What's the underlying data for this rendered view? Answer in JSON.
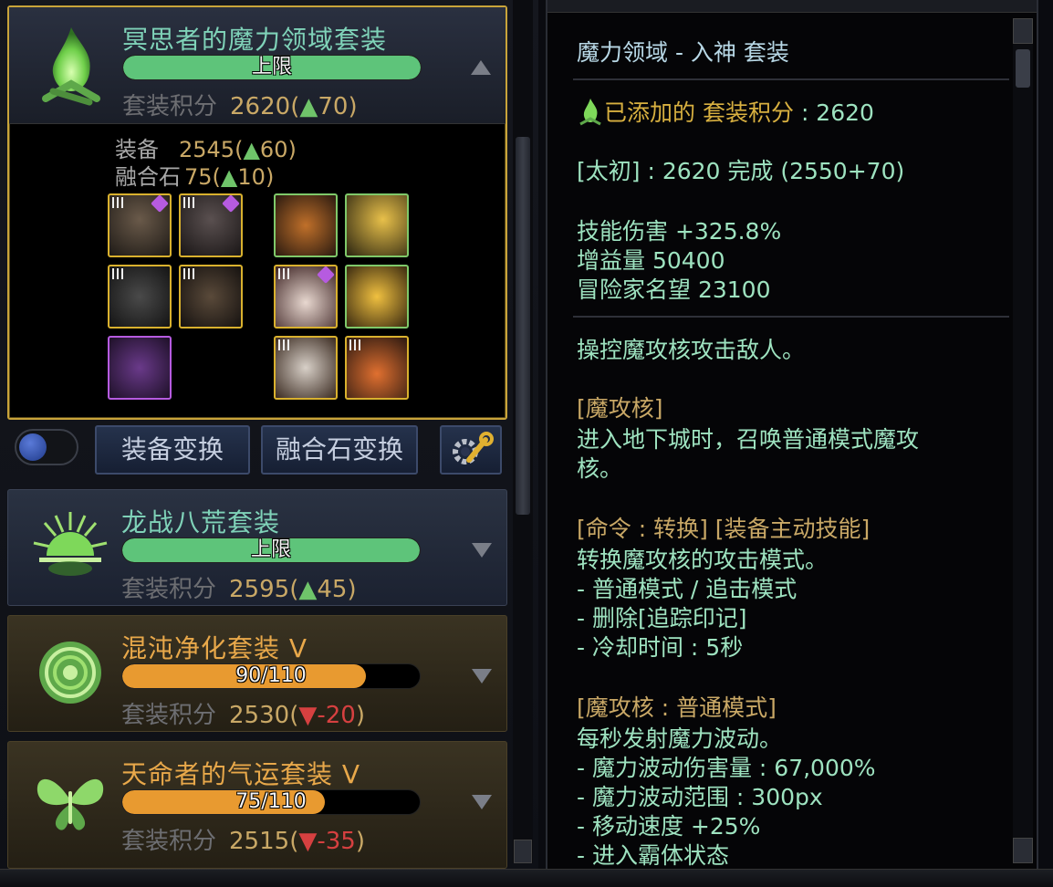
{
  "sets": [
    {
      "name": "冥思者的魔力领域套装",
      "bar_text": "上限",
      "bar_fill": 1.0,
      "score_label": "套装积分",
      "score": "2620",
      "delta_arrow": "▲",
      "delta": "70",
      "delta_dir": "up",
      "equip_label": "装备",
      "equip_value": "2545",
      "equip_delta": "60",
      "stone_label": "融合石",
      "stone_value": "75",
      "stone_delta": "10"
    },
    {
      "name": "龙战八荒套装",
      "bar_text": "上限",
      "bar_fill": 1.0,
      "score_label": "套装积分",
      "score": "2595",
      "delta_arrow": "▲",
      "delta": "45",
      "delta_dir": "up"
    },
    {
      "name": "混沌净化套装 V",
      "bar_text": "90/110",
      "bar_fill": 0.818,
      "score_label": "套装积分",
      "score": "2530",
      "delta_arrow": "▼",
      "delta": "-20",
      "delta_dir": "down"
    },
    {
      "name": "天命者的气运套装 V",
      "bar_text": "75/110",
      "bar_fill": 0.682,
      "score_label": "套装积分",
      "score": "2515",
      "delta_arrow": "▼",
      "delta": "-35",
      "delta_dir": "down"
    }
  ],
  "buttons": {
    "equip_switch": "装备变换",
    "stone_switch": "融合石变换"
  },
  "colors": {
    "frame_gold": "#c9a43a",
    "bar_green": "#5ec47a",
    "bar_orange": "#e89a30",
    "text_green": "#9ee3c0",
    "text_orange": "#c9a866"
  },
  "detail": {
    "title": "魔力领域 - 入神 套装",
    "added_prefix": "已添加的",
    "added_label": "套装积分",
    "added_value": ": 2620",
    "taichu": "[太初] : 2620 完成 (2550+70)",
    "stat1": "技能伤害 +325.8%",
    "stat2": "增益量 50400",
    "stat3": "冒险家名望 23100",
    "desc1": "操控魔攻核攻击敌人。",
    "sec1_title": "[魔攻核]",
    "sec1_line1": "进入地下城时，召唤普通模式魔攻",
    "sec1_line2": "核。",
    "sec2_title_a": "[命令 : 转换]",
    "sec2_title_b": "[装备主动技能]",
    "sec2_line1": "转换魔攻核的攻击模式。",
    "sec2_line2": "- 普通模式 / 追击模式",
    "sec2_line3": "- 删除[追踪印记]",
    "sec2_line4": "- 冷却时间 : 5秒",
    "sec3_title": "[魔攻核 : 普通模式]",
    "sec3_line1": "每秒发射魔力波动。",
    "sec3_line2": "- 魔力波动伤害量 : 67,000%",
    "sec3_line3": "- 魔力波动范围 : 300px",
    "sec3_line4": "- 移动速度 +25%",
    "sec3_line5": "- 进入霸体状态"
  },
  "icons": {
    "set1": "green-flame-icon",
    "set2": "rising-sun-icon",
    "set3": "rose-icon",
    "set4": "butterfly-icon",
    "settings": "wrench-gear-icon"
  }
}
